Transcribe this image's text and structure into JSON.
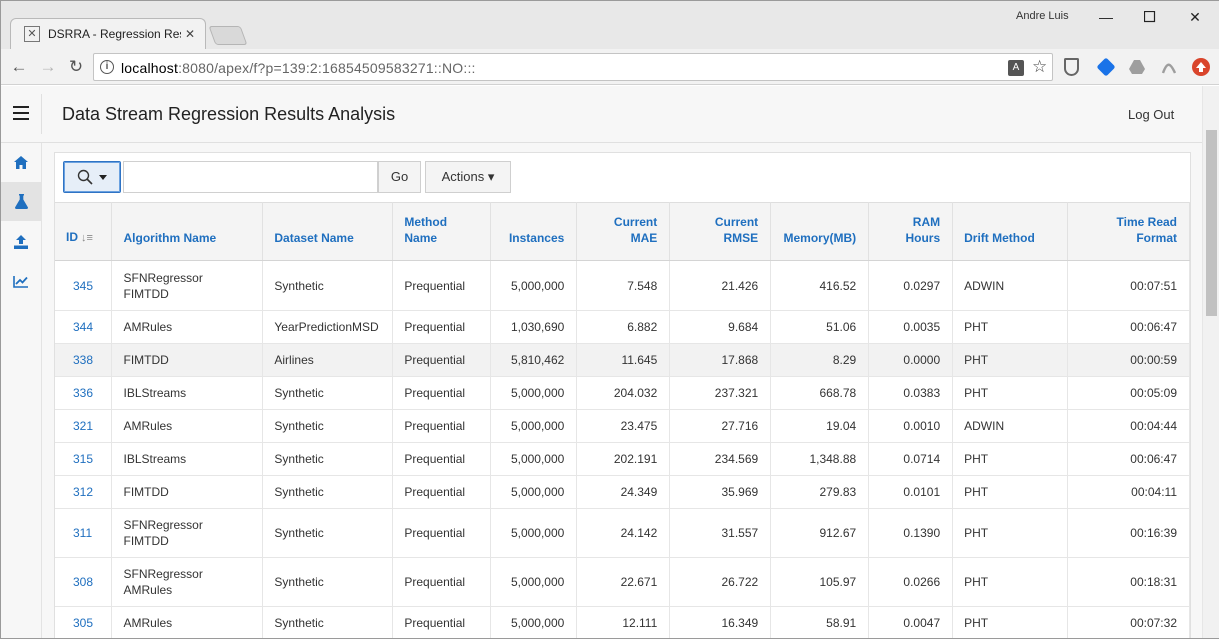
{
  "browser": {
    "tab_title": "DSRRA - Regression Resu",
    "user_name": "Andre Luis",
    "url_host": "localhost",
    "url_rest": ":8080/apex/f?p=139:2:16854509583271::NO:::"
  },
  "app": {
    "title": "Data Stream Regression Results Analysis",
    "logout_label": "Log Out"
  },
  "toolbar": {
    "go_label": "Go",
    "actions_label": "Actions ▾",
    "search_value": ""
  },
  "sidenav": {
    "items": [
      {
        "icon": "home-icon"
      },
      {
        "icon": "flask-icon"
      },
      {
        "icon": "upload-icon"
      },
      {
        "icon": "chart-icon"
      }
    ]
  },
  "table": {
    "headers": {
      "id": "ID",
      "algorithm": "Algorithm Name",
      "dataset": "Dataset Name",
      "method_1": "Method",
      "method_2": "Name",
      "instances": "Instances",
      "mae_1": "Current",
      "mae_2": "MAE",
      "rmse_1": "Current",
      "rmse_2": "RMSE",
      "memory": "Memory(MB)",
      "ram_1": "RAM",
      "ram_2": "Hours",
      "drift": "Drift Method",
      "time_1": "Time Read",
      "time_2": "Format"
    },
    "rows": [
      {
        "id": "345",
        "algo_1": "SFNRegressor",
        "algo_2": "FIMTDD",
        "dataset": "Synthetic",
        "method": "Prequential",
        "instances": "5,000,000",
        "mae": "7.548",
        "rmse": "21.426",
        "memory": "416.52",
        "ram": "0.0297",
        "drift": "ADWIN",
        "time": "00:07:51"
      },
      {
        "id": "344",
        "algo_1": "AMRules",
        "algo_2": "",
        "dataset": "YearPredictionMSD",
        "method": "Prequential",
        "instances": "1,030,690",
        "mae": "6.882",
        "rmse": "9.684",
        "memory": "51.06",
        "ram": "0.0035",
        "drift": "PHT",
        "time": "00:06:47"
      },
      {
        "id": "338",
        "algo_1": "FIMTDD",
        "algo_2": "",
        "dataset": "Airlines",
        "method": "Prequential",
        "instances": "5,810,462",
        "mae": "11.645",
        "rmse": "17.868",
        "memory": "8.29",
        "ram": "0.0000",
        "drift": "PHT",
        "time": "00:00:59"
      },
      {
        "id": "336",
        "algo_1": "IBLStreams",
        "algo_2": "",
        "dataset": "Synthetic",
        "method": "Prequential",
        "instances": "5,000,000",
        "mae": "204.032",
        "rmse": "237.321",
        "memory": "668.78",
        "ram": "0.0383",
        "drift": "PHT",
        "time": "00:05:09"
      },
      {
        "id": "321",
        "algo_1": "AMRules",
        "algo_2": "",
        "dataset": "Synthetic",
        "method": "Prequential",
        "instances": "5,000,000",
        "mae": "23.475",
        "rmse": "27.716",
        "memory": "19.04",
        "ram": "0.0010",
        "drift": "ADWIN",
        "time": "00:04:44"
      },
      {
        "id": "315",
        "algo_1": "IBLStreams",
        "algo_2": "",
        "dataset": "Synthetic",
        "method": "Prequential",
        "instances": "5,000,000",
        "mae": "202.191",
        "rmse": "234.569",
        "memory": "1,348.88",
        "ram": "0.0714",
        "drift": "PHT",
        "time": "00:06:47"
      },
      {
        "id": "312",
        "algo_1": "FIMTDD",
        "algo_2": "",
        "dataset": "Synthetic",
        "method": "Prequential",
        "instances": "5,000,000",
        "mae": "24.349",
        "rmse": "35.969",
        "memory": "279.83",
        "ram": "0.0101",
        "drift": "PHT",
        "time": "00:04:11"
      },
      {
        "id": "311",
        "algo_1": "SFNRegressor",
        "algo_2": "FIMTDD",
        "dataset": "Synthetic",
        "method": "Prequential",
        "instances": "5,000,000",
        "mae": "24.142",
        "rmse": "31.557",
        "memory": "912.67",
        "ram": "0.1390",
        "drift": "PHT",
        "time": "00:16:39"
      },
      {
        "id": "308",
        "algo_1": "SFNRegressor",
        "algo_2": "AMRules",
        "dataset": "Synthetic",
        "method": "Prequential",
        "instances": "5,000,000",
        "mae": "22.671",
        "rmse": "26.722",
        "memory": "105.97",
        "ram": "0.0266",
        "drift": "PHT",
        "time": "00:18:31"
      },
      {
        "id": "305",
        "algo_1": "AMRules",
        "algo_2": "",
        "dataset": "Synthetic",
        "method": "Prequential",
        "instances": "5,000,000",
        "mae": "12.111",
        "rmse": "16.349",
        "memory": "58.91",
        "ram": "0.0047",
        "drift": "PHT",
        "time": "00:07:32"
      }
    ]
  },
  "colors": {
    "link": "#1f6fbf",
    "highlight_row": "#f2f2f2",
    "search_accent": "#2f73c4"
  }
}
